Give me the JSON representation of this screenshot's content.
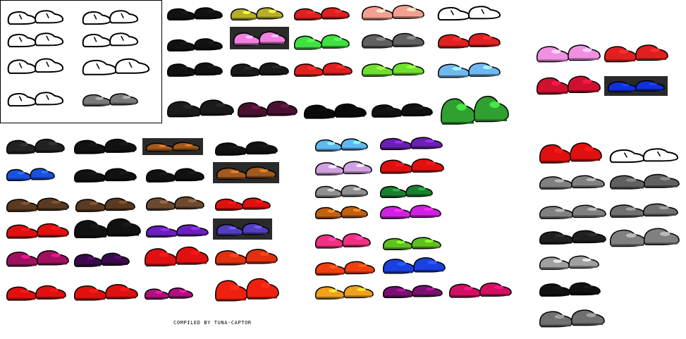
{
  "credit": "COMPILED BY TUNA-CAPTOR",
  "colors": {
    "background": "#ffffff",
    "outline": "#000000",
    "dark_panel": "#2a2a2a"
  },
  "sprites": [
    {
      "id": "outline-sneaker-1",
      "color": "#ffffff",
      "style": "outline"
    },
    {
      "id": "outline-sneaker-2",
      "color": "#ffffff",
      "style": "outline"
    },
    {
      "id": "outline-sneaker-3",
      "color": "#ffffff",
      "style": "outline"
    },
    {
      "id": "outline-sneaker-4",
      "color": "#ffffff",
      "style": "outline"
    },
    {
      "id": "outline-sneaker-5",
      "color": "#ffffff",
      "style": "outline"
    },
    {
      "id": "outline-sneaker-6",
      "color": "#ffffff",
      "style": "outline"
    },
    {
      "id": "outline-sneaker-7",
      "color": "#ffffff",
      "style": "outline"
    },
    {
      "id": "grey-sneaker",
      "color": "#7a7a7a",
      "style": "solid"
    },
    {
      "id": "black-shoe-1",
      "color": "#111111",
      "style": "solid"
    },
    {
      "id": "olive-shoe",
      "color": "#b5b02a",
      "style": "solid"
    },
    {
      "id": "red-yellow-shoe",
      "color": "#e02020",
      "style": "solid"
    },
    {
      "id": "salmon-shoe",
      "color": "#f4a090",
      "style": "solid"
    },
    {
      "id": "white-sneaker",
      "color": "#ffffff",
      "style": "outline"
    },
    {
      "id": "black-shoe-2",
      "color": "#111111",
      "style": "solid"
    },
    {
      "id": "pink-shoe-panel",
      "color": "#f080e0",
      "style": "panel"
    },
    {
      "id": "green-shoe",
      "color": "#40e040",
      "style": "solid"
    },
    {
      "id": "grey-shoe",
      "color": "#606060",
      "style": "solid"
    },
    {
      "id": "red-white-sneaker",
      "color": "#e02020",
      "style": "solid"
    },
    {
      "id": "black-shoe-3",
      "color": "#111111",
      "style": "solid"
    },
    {
      "id": "black-shoe-4",
      "color": "#1a1a1a",
      "style": "solid"
    },
    {
      "id": "red-stripe-shoe",
      "color": "#e02020",
      "style": "solid"
    },
    {
      "id": "lime-shoe",
      "color": "#70e030",
      "style": "solid"
    },
    {
      "id": "light-blue-shoe",
      "color": "#70b8f0",
      "style": "solid"
    },
    {
      "id": "black-boot-1",
      "color": "#1a1a1a",
      "style": "solid"
    },
    {
      "id": "dark-purple-shoe",
      "color": "#4a1030",
      "style": "solid"
    },
    {
      "id": "black-boot-2",
      "color": "#0a0a0a",
      "style": "solid"
    },
    {
      "id": "black-cyan-shoe",
      "color": "#111111",
      "style": "solid"
    },
    {
      "id": "green-gold-shoe",
      "color": "#30a030",
      "style": "solid"
    },
    {
      "id": "pink-yellow-sneaker",
      "color": "#f090e0",
      "style": "solid"
    },
    {
      "id": "red-yellow-sneaker",
      "color": "#e02020",
      "style": "solid"
    },
    {
      "id": "red-green-sneaker",
      "color": "#d01030",
      "style": "solid"
    },
    {
      "id": "blue-shoe-panel",
      "color": "#1030e0",
      "style": "panel"
    },
    {
      "id": "black-shoe-5",
      "color": "#222222",
      "style": "solid"
    },
    {
      "id": "black-sneaker-6",
      "color": "#111111",
      "style": "solid"
    },
    {
      "id": "brown-sandal-panel",
      "color": "#a05a20",
      "style": "panel"
    },
    {
      "id": "black-white-shoe",
      "color": "#111111",
      "style": "solid"
    },
    {
      "id": "blue-shoe",
      "color": "#1a50e0",
      "style": "solid"
    },
    {
      "id": "black-grey-shoe",
      "color": "#111111",
      "style": "solid"
    },
    {
      "id": "black-shoe-7",
      "color": "#111111",
      "style": "solid"
    },
    {
      "id": "brown-sandal-panel-2",
      "color": "#a05a20",
      "style": "panel"
    },
    {
      "id": "brown-shoe-1",
      "color": "#5a3a20",
      "style": "solid"
    },
    {
      "id": "brown-shoe-2",
      "color": "#5a3a20",
      "style": "solid"
    },
    {
      "id": "brown-shoe-3",
      "color": "#6a4a30",
      "style": "solid"
    },
    {
      "id": "red-shoe-1",
      "color": "#e01010",
      "style": "solid"
    },
    {
      "id": "red-white-shoe",
      "color": "#e01010",
      "style": "solid"
    },
    {
      "id": "black-cleat",
      "color": "#111111",
      "style": "solid"
    },
    {
      "id": "purple-shoe-1",
      "color": "#6a20c0",
      "style": "solid"
    },
    {
      "id": "purple-shoe-panel",
      "color": "#5040c0",
      "style": "panel"
    },
    {
      "id": "magenta-shoe-1",
      "color": "#a01060",
      "style": "solid"
    },
    {
      "id": "dark-purple-shoe-2",
      "color": "#3a0a4a",
      "style": "solid"
    },
    {
      "id": "red-boot-1",
      "color": "#e01010",
      "style": "solid"
    },
    {
      "id": "red-orange-shoe",
      "color": "#e03010",
      "style": "solid"
    },
    {
      "id": "red-shoe-2",
      "color": "#e01010",
      "style": "solid"
    },
    {
      "id": "red-shoe-3",
      "color": "#e01010",
      "style": "solid"
    },
    {
      "id": "magenta-small-shoe",
      "color": "#b01080",
      "style": "solid"
    },
    {
      "id": "red-boot-2",
      "color": "#f02010",
      "style": "solid"
    },
    {
      "id": "sky-blue-shoe",
      "color": "#60b8f0",
      "style": "solid"
    },
    {
      "id": "violet-shoe",
      "color": "#6a20b0",
      "style": "solid"
    },
    {
      "id": "lilac-shoe",
      "color": "#d0a0e0",
      "style": "solid"
    },
    {
      "id": "red-shoe-4",
      "color": "#e01010",
      "style": "solid"
    },
    {
      "id": "grey-shoe-2",
      "color": "#909090",
      "style": "solid"
    },
    {
      "id": "dark-green-shoe",
      "color": "#1a8030",
      "style": "solid"
    },
    {
      "id": "orange-shoe",
      "color": "#c06010",
      "style": "solid"
    },
    {
      "id": "magenta-shoe-2",
      "color": "#d020e0",
      "style": "solid"
    },
    {
      "id": "hot-pink-shoe",
      "color": "#f03080",
      "style": "solid"
    },
    {
      "id": "leaf-green-shoe",
      "color": "#60c020",
      "style": "solid"
    },
    {
      "id": "orange-red-shoe",
      "color": "#f04010",
      "style": "solid"
    },
    {
      "id": "royal-blue-shoe",
      "color": "#1a40e0",
      "style": "solid"
    },
    {
      "id": "golden-shoe",
      "color": "#f0a020",
      "style": "solid"
    },
    {
      "id": "plum-shoe",
      "color": "#7a1070",
      "style": "solid"
    },
    {
      "id": "crimson-pink-shoe",
      "color": "#d01060",
      "style": "solid"
    },
    {
      "id": "red-boot-3",
      "color": "#e01010",
      "style": "solid"
    },
    {
      "id": "grey-slipper-1",
      "color": "#c0c0c0",
      "style": "outline"
    },
    {
      "id": "grey-shoe-3",
      "color": "#808080",
      "style": "solid"
    },
    {
      "id": "grey-curl-shoe",
      "color": "#606060",
      "style": "solid"
    },
    {
      "id": "grey-white-shoe",
      "color": "#808080",
      "style": "solid"
    },
    {
      "id": "grey-curl-shoe-2",
      "color": "#707070",
      "style": "solid"
    },
    {
      "id": "black-white-shoe-2",
      "color": "#202020",
      "style": "solid"
    },
    {
      "id": "grey-boot",
      "color": "#808080",
      "style": "solid"
    },
    {
      "id": "grey-shoe-4",
      "color": "#a0a0a0",
      "style": "solid"
    },
    {
      "id": "black-shoe-8",
      "color": "#111111",
      "style": "solid"
    },
    {
      "id": "grey-spiky-shoe",
      "color": "#707070",
      "style": "solid"
    }
  ]
}
